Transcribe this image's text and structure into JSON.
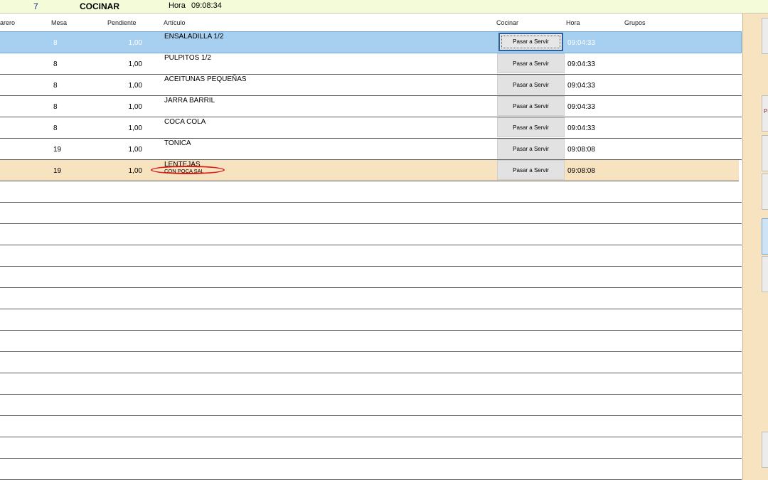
{
  "top_bar": {
    "count": "7",
    "title": "COCINAR",
    "hora_label": "Hora",
    "hora_value": "09:08:34"
  },
  "columns": {
    "waiter": "arero",
    "mesa": "Mesa",
    "pendiente": "Pendiente",
    "articulo": "Artículo",
    "cocinar": "Cocinar",
    "hora": "Hora",
    "grupos": "Grupos"
  },
  "rows": [
    {
      "mesa": "8",
      "pendiente": "1,00",
      "articulo": "ENSALADILLA 1/2",
      "note": "",
      "button": "Pasar a Servir",
      "hora": "09:04:33"
    },
    {
      "mesa": "8",
      "pendiente": "1,00",
      "articulo": "PULPITOS 1/2",
      "note": "",
      "button": "Pasar a Servir",
      "hora": "09:04:33"
    },
    {
      "mesa": "8",
      "pendiente": "1,00",
      "articulo": "ACEITUNAS PEQUEÑAS",
      "note": "",
      "button": "Pasar a Servir",
      "hora": "09:04:33"
    },
    {
      "mesa": "8",
      "pendiente": "1,00",
      "articulo": "JARRA BARRIL",
      "note": "",
      "button": "Pasar a Servir",
      "hora": "09:04:33"
    },
    {
      "mesa": "8",
      "pendiente": "1,00",
      "articulo": "COCA COLA",
      "note": "",
      "button": "Pasar a Servir",
      "hora": "09:04:33"
    },
    {
      "mesa": "19",
      "pendiente": "1,00",
      "articulo": "TONICA",
      "note": "",
      "button": "Pasar a Servir",
      "hora": "09:08:08"
    },
    {
      "mesa": "19",
      "pendiente": "1,00",
      "articulo": "LENTEJAS",
      "note": "CON POCA SAL",
      "button": "Pasar a Servir",
      "hora": "09:08:08"
    }
  ],
  "right_panel": {
    "partial_label": "Pa"
  },
  "colors": {
    "selected_row": "#a7cfef",
    "highlight_row": "#f7e3c0",
    "top_bar": "#f3fbd9",
    "annotation": "#d81a1a"
  }
}
